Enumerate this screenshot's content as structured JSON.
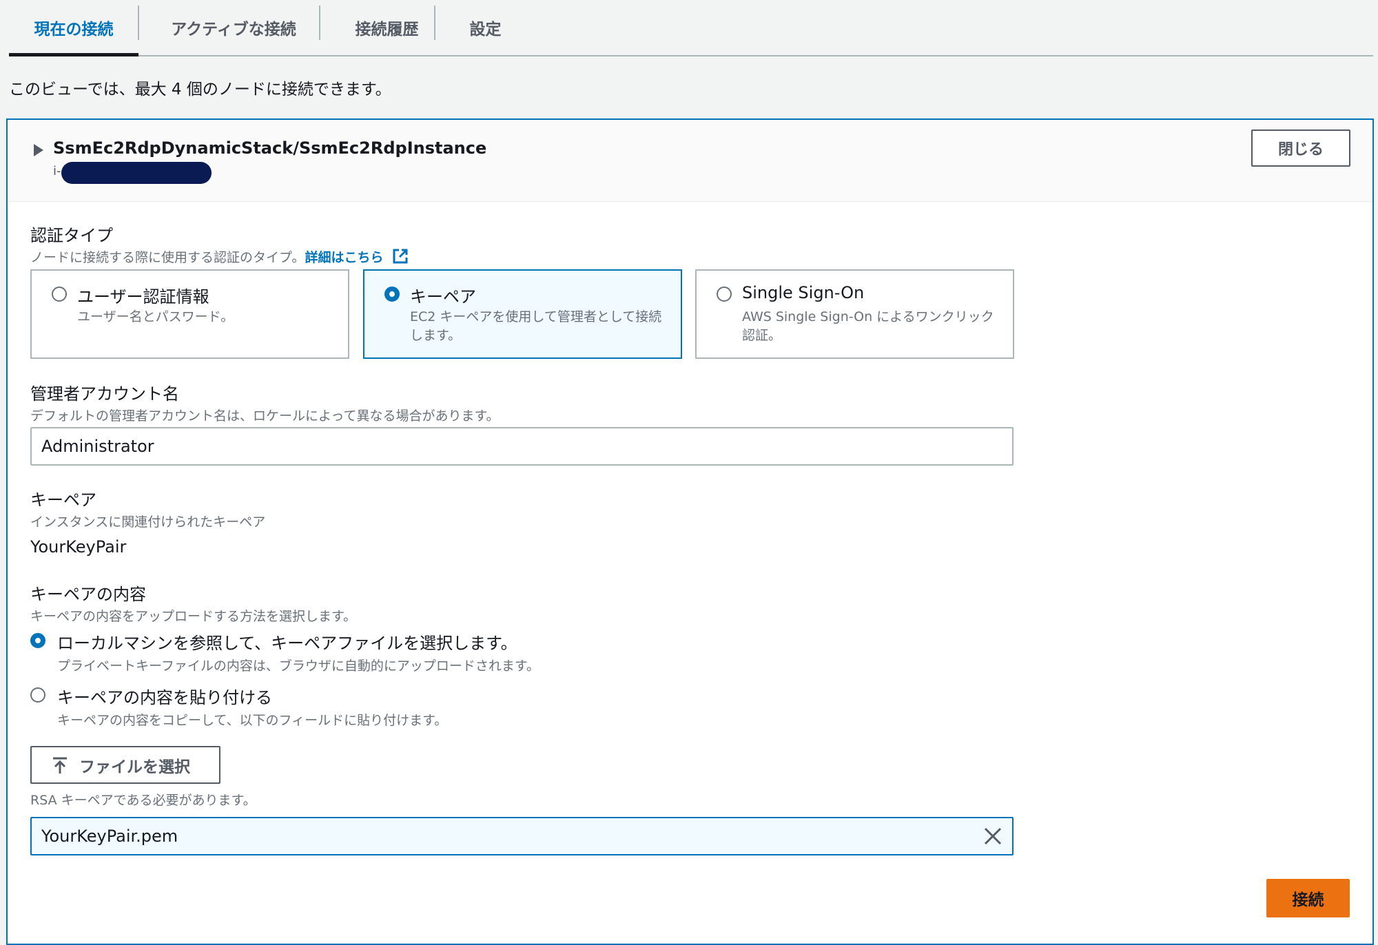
{
  "tabs": [
    {
      "label": "現在の接続"
    },
    {
      "label": "アクティブな接続"
    },
    {
      "label": "接続履歴"
    },
    {
      "label": "設定"
    }
  ],
  "intro": "このビューでは、最大 4 個のノードに接続できます。",
  "node": {
    "title": "SsmEc2RdpDynamicStack/SsmEc2RdpInstance",
    "id_prefix": "i-",
    "close_label": "閉じる"
  },
  "auth": {
    "label": "認証タイプ",
    "desc": "ノードに接続する際に使用する認証のタイプ。",
    "link": "詳細はこちら",
    "options": [
      {
        "title": "ユーザー認証情報",
        "desc": "ユーザー名とパスワード。",
        "selected": false
      },
      {
        "title": "キーペア",
        "desc": "EC2 キーペアを使用して管理者として接続します。",
        "selected": true
      },
      {
        "title": "Single Sign-On",
        "desc": "AWS Single Sign-On によるワンクリック認証。",
        "selected": false
      }
    ]
  },
  "admin": {
    "label": "管理者アカウント名",
    "desc": "デフォルトの管理者アカウント名は、ロケールによって異なる場合があります。",
    "value": "Administrator"
  },
  "keypair": {
    "label": "キーペア",
    "desc": "インスタンスに関連付けられたキーペア",
    "value": "YourKeyPair"
  },
  "content": {
    "label": "キーペアの内容",
    "desc": "キーペアの内容をアップロードする方法を選択します。",
    "options": [
      {
        "title": "ローカルマシンを参照して、キーペアファイルを選択します。",
        "desc": "プライベートキーファイルの内容は、ブラウザに自動的にアップロードされます。",
        "selected": true
      },
      {
        "title": "キーペアの内容を貼り付ける",
        "desc": "キーペアの内容をコピーして、以下のフィールドに貼り付けます。",
        "selected": false
      }
    ]
  },
  "file": {
    "button_label": "ファイルを選択",
    "hint": "RSA キーペアである必要があります。",
    "selected_file": "YourKeyPair.pem"
  },
  "connect_label": "接続",
  "colors": {
    "accent": "#0073bb",
    "primary_button": "#ec7211"
  }
}
